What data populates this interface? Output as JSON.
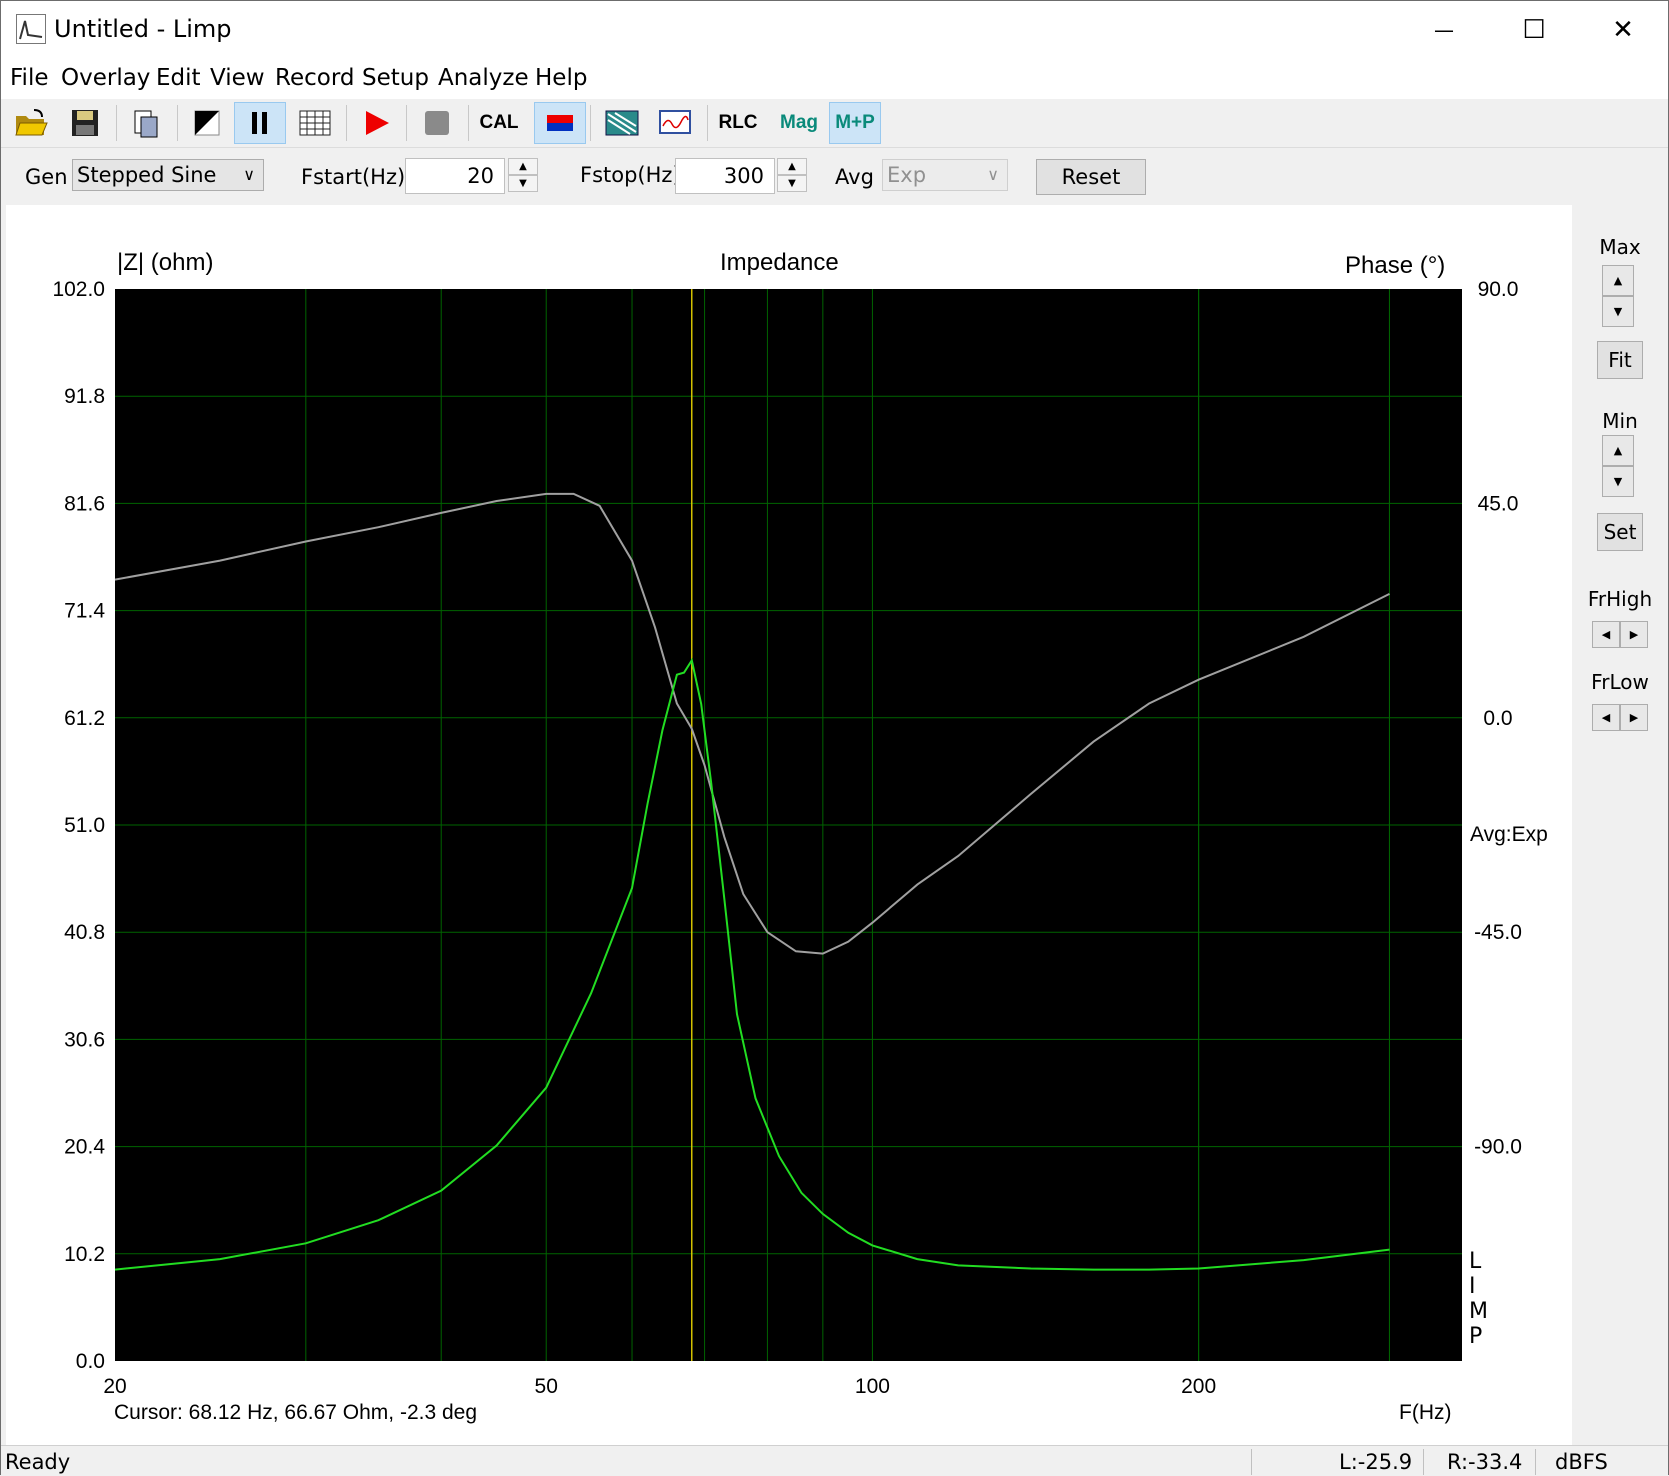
{
  "window": {
    "title": "Untitled - Limp",
    "minimize_glyph": "—",
    "maximize_glyph": "☐",
    "close_glyph": "✕"
  },
  "menu": [
    "File",
    "Overlay",
    "Edit",
    "View",
    "Record",
    "Setup",
    "Analyze",
    "Help"
  ],
  "toolbar": {
    "cal": "CAL",
    "rlc": "RLC",
    "mag": "Mag",
    "mp": "M+P",
    "icons": [
      "open-folder-icon",
      "save-icon",
      "copy-icon",
      "contrast-icon",
      "pause-icon",
      "grid-icon",
      "record-icon",
      "stop-icon",
      "cal-button",
      "color-icon",
      "scope-icon",
      "wave-icon",
      "rlc-button",
      "mag-button",
      "mp-button"
    ]
  },
  "params": {
    "gen_label": "Gen",
    "gen_value": "Stepped Sine",
    "fstart_label": "Fstart(Hz)",
    "fstart_value": "20",
    "fstop_label": "Fstop(Hz)",
    "fstop_value": "300",
    "avg_label": "Avg",
    "avg_value": "Exp",
    "reset_label": "Reset"
  },
  "plot": {
    "left_axis_title": "|Z| (ohm)",
    "title": "Impedance",
    "right_axis_title": "Phase (°)",
    "avg_annotation": "Avg:Exp",
    "brand_letters": [
      "L",
      "I",
      "M",
      "P"
    ],
    "cursor_readout": "Cursor: 68.12 Hz, 66.67 Ohm, -2.3 deg",
    "x_axis_title": "F(Hz)"
  },
  "right_panel": {
    "max": "Max",
    "fit": "Fit",
    "min": "Min",
    "set": "Set",
    "frhigh": "FrHigh",
    "frlow": "FrLow"
  },
  "status": {
    "ready": "Ready",
    "left": "L:-25.9",
    "right": "R:-33.4",
    "unit": "dBFS"
  },
  "colors": {
    "plot_bg": "#000000",
    "grid": "#006400",
    "impedance": "#22dd22",
    "phase": "#a0a0a0",
    "cursor": "#d4c200"
  },
  "chart_data": {
    "type": "line",
    "title": "Impedance",
    "xlabel": "F(Hz)",
    "ylabel": "|Z| (ohm)",
    "y2label": "Phase (°)",
    "xscale": "log",
    "xlim": [
      20,
      350
    ],
    "ylim": [
      0,
      102
    ],
    "y2lim": [
      -135,
      90
    ],
    "x_ticks": [
      "20",
      "50",
      "100",
      "200"
    ],
    "x_tick_values": [
      20,
      50,
      100,
      200
    ],
    "y_ticks": [
      "0.0",
      "10.2",
      "20.4",
      "30.6",
      "40.8",
      "51.0",
      "61.2",
      "71.4",
      "81.6",
      "91.8",
      "102.0"
    ],
    "y2_ticks": [
      "90.0",
      "45.0",
      "0.0",
      "-45.0",
      "-90.0"
    ],
    "y2_tick_values": [
      90,
      45,
      0,
      -45,
      -90
    ],
    "cursor_x": 68.12,
    "series": [
      {
        "name": "|Z|",
        "axis": "left",
        "x": [
          20,
          25,
          30,
          35,
          40,
          45,
          50,
          55,
          60,
          62,
          64,
          66,
          67,
          68.12,
          69.5,
          71,
          73,
          75,
          78,
          82,
          86,
          90,
          95,
          100,
          110,
          120,
          140,
          160,
          180,
          200,
          250,
          300
        ],
        "values": [
          8.7,
          9.7,
          11.2,
          13.4,
          16.2,
          20.5,
          26.0,
          35.0,
          45.0,
          53.0,
          60.0,
          65.3,
          65.5,
          66.67,
          62.5,
          55.0,
          44.0,
          33.0,
          25.0,
          19.5,
          16.0,
          14.0,
          12.2,
          11.0,
          9.7,
          9.1,
          8.8,
          8.7,
          8.7,
          8.8,
          9.6,
          10.6
        ]
      },
      {
        "name": "Phase",
        "axis": "right",
        "x": [
          20,
          25,
          30,
          35,
          40,
          45,
          50,
          53,
          56,
          60,
          63,
          66,
          68.12,
          70,
          73,
          76,
          80,
          85,
          90,
          95,
          100,
          110,
          120,
          140,
          160,
          180,
          200,
          250,
          300
        ],
        "values": [
          29,
          33,
          37,
          40,
          43,
          45.5,
          47,
          47,
          44.5,
          33,
          19,
          3,
          -2.3,
          -10,
          -25,
          -37,
          -45,
          -49,
          -49.5,
          -47,
          -43,
          -35,
          -29,
          -16,
          -5,
          3,
          8,
          17,
          26
        ]
      }
    ]
  }
}
